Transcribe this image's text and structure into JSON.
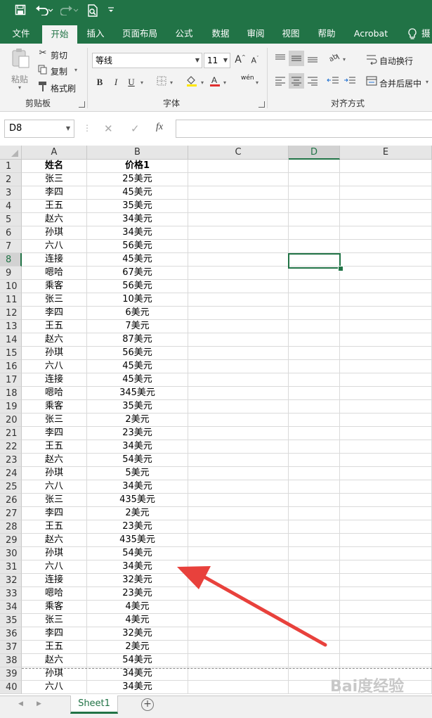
{
  "qat": {
    "save": "save-icon",
    "undo": "undo-icon",
    "redo": "redo-icon",
    "preview": "print-preview-icon",
    "customize": "customize-qat-icon"
  },
  "tabs": [
    "文件",
    "开始",
    "插入",
    "页面布局",
    "公式",
    "数据",
    "审阅",
    "视图",
    "帮助",
    "Acrobat",
    "摄"
  ],
  "active_tab": "开始",
  "ribbon": {
    "clipboard": {
      "paste": "粘贴",
      "cut": "剪切",
      "copy": "复制",
      "format_painter": "格式刷",
      "label": "剪贴板"
    },
    "font": {
      "font_name": "等线",
      "font_size": "11",
      "bold": "B",
      "italic": "I",
      "underline": "U",
      "label": "字体",
      "wen": "wén"
    },
    "alignment": {
      "wrap_text": "自动换行",
      "merge_center": "合并后居中",
      "label": "对齐方式"
    }
  },
  "formula_bar": {
    "name_box": "D8",
    "fx": "fx",
    "value": ""
  },
  "columns": [
    "A",
    "B",
    "C",
    "D",
    "E"
  ],
  "selected_column": "D",
  "selected_row": 8,
  "rows": [
    {
      "n": "1",
      "a": "姓名",
      "b": "价格1"
    },
    {
      "n": "2",
      "a": "张三",
      "b": "25美元"
    },
    {
      "n": "3",
      "a": "李四",
      "b": "45美元"
    },
    {
      "n": "4",
      "a": "王五",
      "b": "35美元"
    },
    {
      "n": "5",
      "a": "赵六",
      "b": "34美元"
    },
    {
      "n": "6",
      "a": "孙琪",
      "b": "34美元"
    },
    {
      "n": "7",
      "a": "六八",
      "b": "56美元"
    },
    {
      "n": "8",
      "a": "连接",
      "b": "45美元"
    },
    {
      "n": "9",
      "a": "嗯哈",
      "b": "67美元"
    },
    {
      "n": "10",
      "a": "乘客",
      "b": "56美元"
    },
    {
      "n": "11",
      "a": "张三",
      "b": "10美元"
    },
    {
      "n": "12",
      "a": "李四",
      "b": "6美元"
    },
    {
      "n": "13",
      "a": "王五",
      "b": "7美元"
    },
    {
      "n": "14",
      "a": "赵六",
      "b": "87美元"
    },
    {
      "n": "15",
      "a": "孙琪",
      "b": "56美元"
    },
    {
      "n": "16",
      "a": "六八",
      "b": "45美元"
    },
    {
      "n": "17",
      "a": "连接",
      "b": "45美元"
    },
    {
      "n": "18",
      "a": "嗯哈",
      "b": "345美元"
    },
    {
      "n": "19",
      "a": "乘客",
      "b": "35美元"
    },
    {
      "n": "20",
      "a": "张三",
      "b": "2美元"
    },
    {
      "n": "21",
      "a": "李四",
      "b": "23美元"
    },
    {
      "n": "22",
      "a": "王五",
      "b": "34美元"
    },
    {
      "n": "23",
      "a": "赵六",
      "b": "54美元"
    },
    {
      "n": "24",
      "a": "孙琪",
      "b": "5美元"
    },
    {
      "n": "25",
      "a": "六八",
      "b": "34美元"
    },
    {
      "n": "26",
      "a": "张三",
      "b": "435美元"
    },
    {
      "n": "27",
      "a": "李四",
      "b": "2美元"
    },
    {
      "n": "28",
      "a": "王五",
      "b": "23美元"
    },
    {
      "n": "29",
      "a": "赵六",
      "b": "435美元"
    },
    {
      "n": "30",
      "a": "孙琪",
      "b": "54美元"
    },
    {
      "n": "31",
      "a": "六八",
      "b": "34美元"
    },
    {
      "n": "32",
      "a": "连接",
      "b": "32美元"
    },
    {
      "n": "33",
      "a": "嗯哈",
      "b": "23美元"
    },
    {
      "n": "34",
      "a": "乘客",
      "b": "4美元"
    },
    {
      "n": "35",
      "a": "张三",
      "b": "4美元"
    },
    {
      "n": "36",
      "a": "李四",
      "b": "32美元"
    },
    {
      "n": "37",
      "a": "王五",
      "b": "2美元"
    },
    {
      "n": "38",
      "a": "赵六",
      "b": "54美元"
    },
    {
      "n": "39",
      "a": "孙琪",
      "b": "34美元"
    },
    {
      "n": "40",
      "a": "六八",
      "b": "34美元"
    }
  ],
  "sheet_tabs": [
    "Sheet1"
  ],
  "colors": {
    "accent": "#217346",
    "arrow": "#e8413c"
  },
  "watermark": "Bai度经验"
}
